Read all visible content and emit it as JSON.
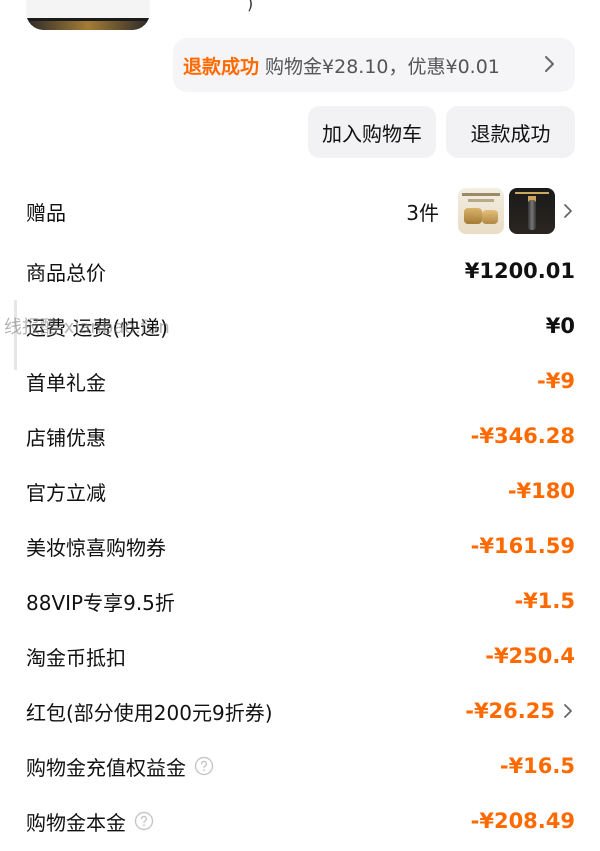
{
  "refund_bar": {
    "status": "退款成功",
    "detail": "购物金¥28.10，优惠¥0.01"
  },
  "actions": {
    "add_to_cart": "加入购物车",
    "refund_success": "退款成功"
  },
  "gift_row": {
    "label": "赠品",
    "count": "3件"
  },
  "price_rows": [
    {
      "label": "商品总价",
      "value": "¥1200.01",
      "color": "#111111"
    },
    {
      "label": "运费  运费(快递)",
      "value": "¥0",
      "color": "#111111"
    },
    {
      "label": "首单礼金",
      "value": "-¥9",
      "color": "#ff6a00"
    },
    {
      "label": "店铺优惠",
      "value": "-¥346.28",
      "color": "#ff6a00"
    },
    {
      "label": "官方立减",
      "value": "-¥180",
      "color": "#ff6a00"
    },
    {
      "label": "美妆惊喜购物券",
      "value": "-¥161.59",
      "color": "#ff6a00"
    },
    {
      "label": "88VIP专享9.5折",
      "value": "-¥1.5",
      "color": "#ff6a00"
    },
    {
      "label": "淘金币抵扣",
      "value": "-¥250.4",
      "color": "#ff6a00"
    },
    {
      "label": "红包(部分使用200元9折券)",
      "value": "-¥26.25",
      "color": "#ff6a00"
    },
    {
      "label": "购物金充值权益金",
      "value": "-¥16.5",
      "color": "#ff6a00"
    },
    {
      "label": "购物金本金",
      "value": "-¥208.49",
      "color": "#ff6a00"
    }
  ],
  "watermark": "线报酷 xianbao.fun",
  "colors": {
    "accent": "#ff6a00",
    "button_bg": "#f2f2f4",
    "bar_bg": "#f5f5f7"
  }
}
